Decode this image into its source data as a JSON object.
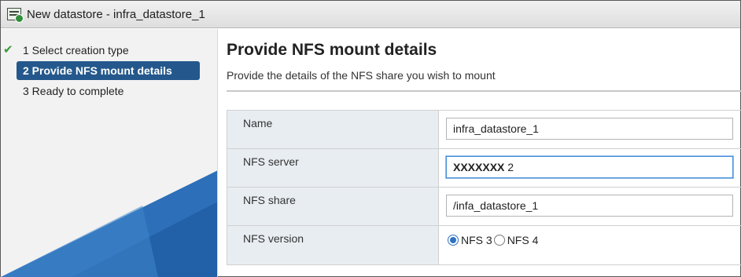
{
  "window": {
    "title": "New datastore - infra_datastore_1",
    "icon": "datastore-add-icon"
  },
  "sidebar": {
    "steps": [
      {
        "label": "1  Select creation type",
        "state": "done"
      },
      {
        "label": "2 Provide NFS mount details",
        "state": "active"
      },
      {
        "label": "3 Ready to complete",
        "state": "pending"
      }
    ]
  },
  "main": {
    "title": "Provide NFS mount details",
    "subtitle": "Provide the details of the NFS share you wish to mount",
    "form": {
      "name": {
        "label": "Name",
        "value": "infra_datastore_1"
      },
      "nfs_server": {
        "label": "NFS server",
        "value": "XXXXXXX",
        "suffix": "2"
      },
      "nfs_share": {
        "label": "NFS share",
        "value": "/infa_datastore_1"
      },
      "nfs_version": {
        "label": "NFS version",
        "options": [
          {
            "label": "NFS 3",
            "selected": true
          },
          {
            "label": "NFS 4",
            "selected": false
          }
        ]
      }
    }
  },
  "colors": {
    "active_step": "#24588c",
    "sidebar_triangle": "#2d6fb8",
    "focus_border": "#4a90d9",
    "check": "#3a9a35"
  }
}
